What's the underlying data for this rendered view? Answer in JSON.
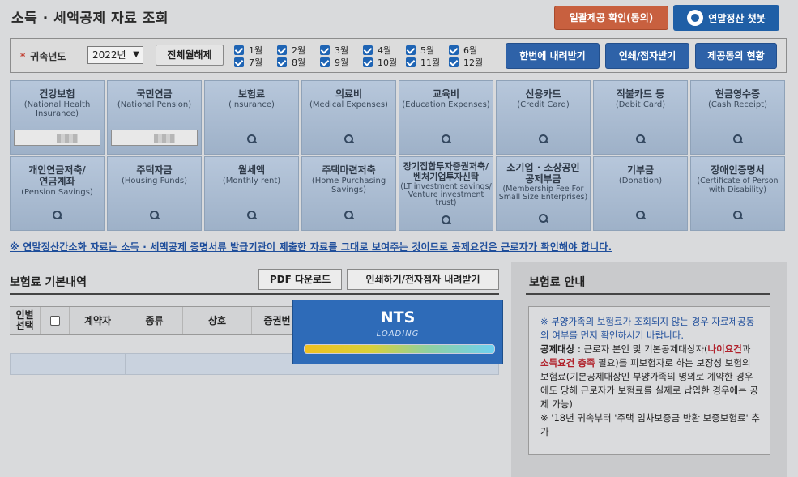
{
  "header": {
    "title": "소득 · 세액공제 자료 조회",
    "consent_button": "일괄제공 확인(동의)",
    "chatbot_button": "연말정산 챗봇"
  },
  "filter": {
    "year_label": "귀속년도",
    "year_value": "2022년",
    "clear_month_button": "전체월해제",
    "months": [
      "1월",
      "2월",
      "3월",
      "4월",
      "5월",
      "6월",
      "7월",
      "8월",
      "9월",
      "10월",
      "11월",
      "12월"
    ],
    "download_all_button": "한번에 내려받기",
    "print_button": "인쇄/점자받기",
    "status_button": "제공동의 현황"
  },
  "categories": [
    {
      "kr": "건강보험",
      "en": "(National Health Insurance)"
    },
    {
      "kr": "국민연금",
      "en": "(National Pension)"
    },
    {
      "kr": "보험료",
      "en": "(Insurance)"
    },
    {
      "kr": "의료비",
      "en": "(Medical Expenses)"
    },
    {
      "kr": "교육비",
      "en": "(Education Expenses)"
    },
    {
      "kr": "신용카드",
      "en": "(Credit Card)"
    },
    {
      "kr": "직불카드 등",
      "en": "(Debit Card)"
    },
    {
      "kr": "현금영수증",
      "en": "(Cash Receipt)"
    },
    {
      "kr": "개인연금저축/\n연금계좌",
      "en": "(Pension Savings)"
    },
    {
      "kr": "주택자금",
      "en": "(Housing Funds)"
    },
    {
      "kr": "월세액",
      "en": "(Monthly rent)"
    },
    {
      "kr": "주택마련저축",
      "en": "(Home Purchasing Savings)"
    },
    {
      "kr": "장기집합투자증권저축/\n벤처기업투자신탁",
      "en": "(LT investment savings/ Venture investment trust)"
    },
    {
      "kr": "소기업 · 소상공인\n공제부금",
      "en": "(Membership Fee For Small Size Enterprises)"
    },
    {
      "kr": "기부금",
      "en": "(Donation)"
    },
    {
      "kr": "장애인증명서",
      "en": "(Certificate of Person with Disability)"
    }
  ],
  "notice": "※ 연말정산간소화 자료는 소득 · 세액공제 증명서류 발급기관이 제출한 자료를 그대로 보여주는 것이므로 공제요건은 근로자가 확인해야 합니다.",
  "main": {
    "section_title": "보험료 기본내역",
    "pdf_button": "PDF 다운로드",
    "print_button": "인쇄하기/전자점자 내려받기",
    "columns": [
      "인별\n선택",
      "계약자",
      "종류",
      "상호",
      "증권번"
    ]
  },
  "loading": {
    "brand": "NTS",
    "text": "LOADING",
    "progress_percent": 100
  },
  "side": {
    "title": "보험료 안내",
    "line1": "※ 부양가족의 보험료가 조회되지 않는 경우 자료제공동의 여부를 먼저 확인하시기 바랍니다.",
    "label_deduct": "공제대상",
    "txt_a": " : 근로자 본인 및 기본공제대상자(",
    "txt_age": "나이요건",
    "txt_b": "과 ",
    "txt_income": "소득요건 충족",
    "txt_c": " 필요)를 피보험자로 하는 보장성 보험의 보험료(기본공제대상인 부양가족의 명의로 계약한 경우에도 당해 근로자가 보험료를 실제로 납입한 경우에는 공제 가능)",
    "line3": "※ '18년 귀속부터 '주택 임차보증금 반환 보증보험료' 추가"
  }
}
